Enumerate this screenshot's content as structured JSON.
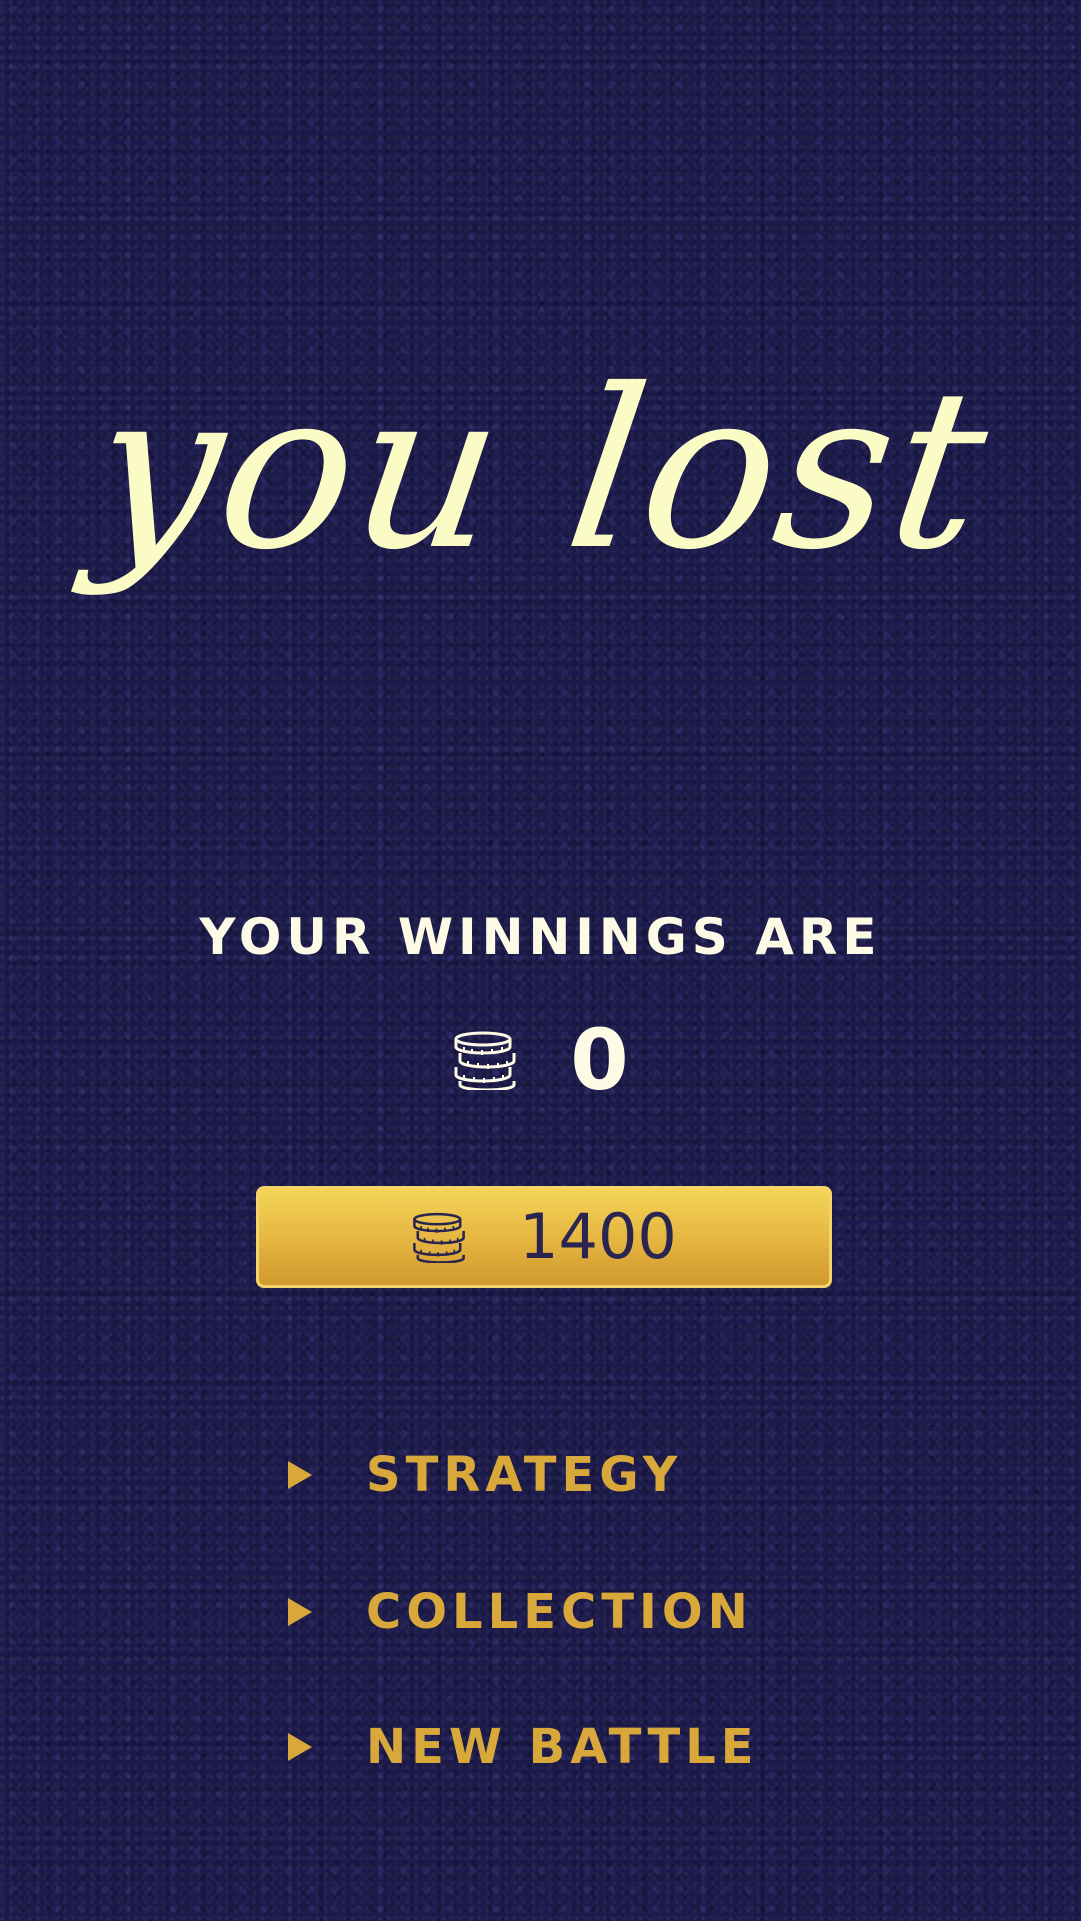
{
  "title": "you lost",
  "winnings": {
    "label": "YOUR WINNINGS ARE",
    "icon": "coins-stack-icon",
    "value": "0"
  },
  "balance": {
    "icon": "coins-stack-icon",
    "value": "1400"
  },
  "menu": {
    "items": [
      {
        "label": "STRATEGY",
        "icon": "play-arrow-icon"
      },
      {
        "label": "COLLECTION",
        "icon": "play-arrow-icon"
      },
      {
        "label": "NEW BATTLE",
        "icon": "play-arrow-icon"
      }
    ]
  },
  "colors": {
    "background": "#1c1a4a",
    "title": "#fbfbc6",
    "text_light": "#fdfbe6",
    "gold": "#d9a83a",
    "gold_bar_top": "#f4d458",
    "gold_bar_bottom": "#d09a2e",
    "balance_text": "#2a2550"
  }
}
